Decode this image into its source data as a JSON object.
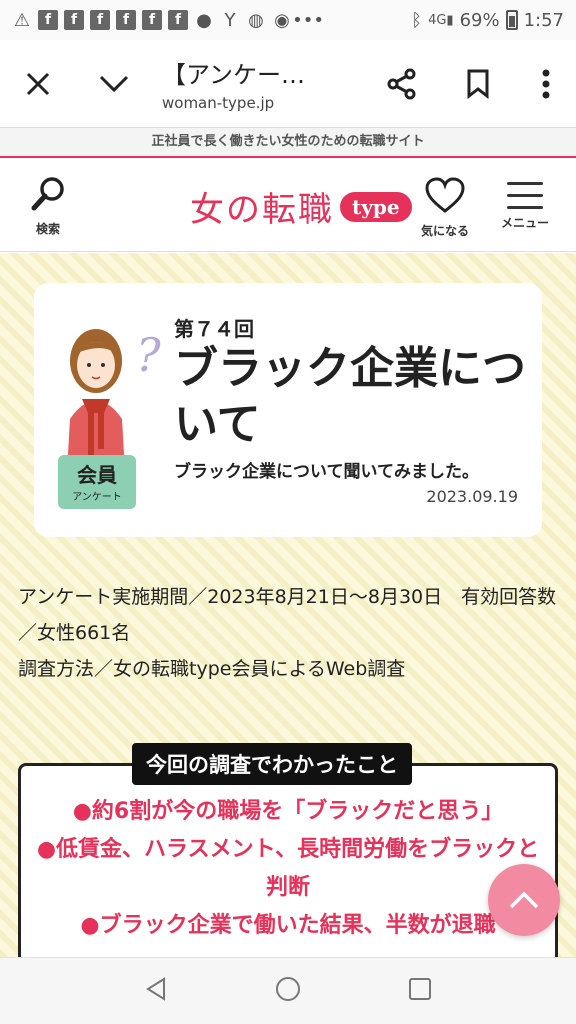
{
  "status_bar": {
    "battery": "69%",
    "time": "1:57"
  },
  "browser": {
    "title": "【アンケー…",
    "url": "woman-type.jp"
  },
  "site": {
    "tagline": "正社員で長く働きたい女性のための転職サイト",
    "search_label": "検索",
    "logo_text": "女の転職",
    "logo_badge": "type",
    "favorite_label": "気になる",
    "menu_label": "メニュー",
    "accent_color": "#e6325a"
  },
  "article": {
    "issue": "第７４回",
    "title": "ブラック企業について",
    "subtitle": "ブラック企業について聞いてみました。",
    "date": "2023.09.19",
    "badge_main": "会員",
    "badge_sub": "アンケート",
    "info_period": "アンケート実施期間／2023年8月21日～8月30日　有効回答数／女性661名",
    "info_method": "調査方法／女の転職type会員によるWeb調査"
  },
  "findings": {
    "heading": "今回の調査でわかったこと",
    "items": [
      "●約6割が今の職場を「ブラックだと思う」",
      "●低賃金、ハラスメント、長時間労働をブラックと判断",
      "●ブラック企業で働いた結果、半数が退職"
    ]
  }
}
